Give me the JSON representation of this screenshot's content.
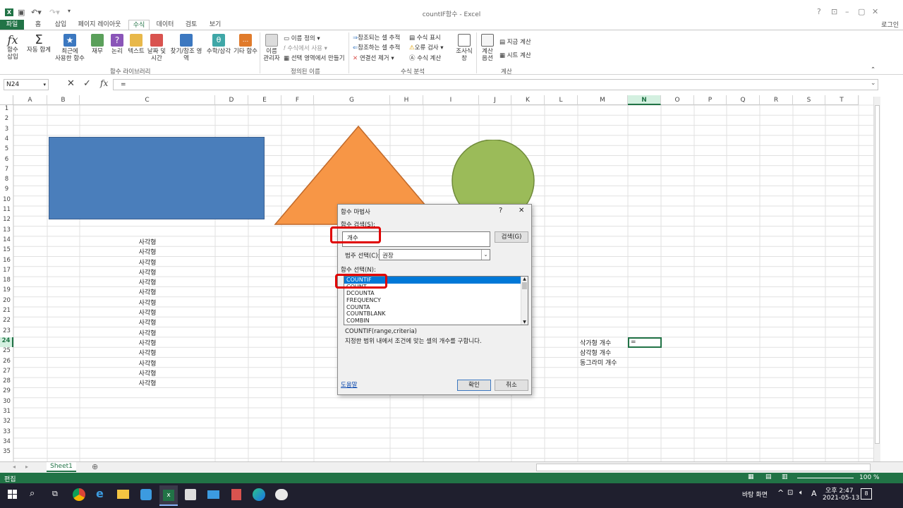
{
  "window": {
    "title": "countIF함수 - Excel",
    "login": "로그인",
    "help_btn": "?",
    "minimize": "–",
    "restore": "▢",
    "close": "✕"
  },
  "tabs": [
    "파일",
    "홈",
    "삽입",
    "페이지 레이아웃",
    "수식",
    "데이터",
    "검토",
    "보기"
  ],
  "ribbon": {
    "insert_function": "fx",
    "insert_function_label1": "함수",
    "insert_function_label2": "삽입",
    "autosum": "자동 합계",
    "recent": "최근에",
    "recent2": "사용한 함수",
    "finance": "재무",
    "logic": "논리",
    "text": "텍스트",
    "datetime": "날짜 및",
    "datetime2": "시간",
    "lookup": "찾기/참조 영역",
    "math": "수학/삼각",
    "more": "기타 함수",
    "group_library": "함수 라이브러리",
    "name_manager": "이름",
    "name_manager2": "관리자",
    "define_name": "이름 정의",
    "use_in_formula": "수식에서 사용",
    "create_from_sel": "선택 영역에서 만들기",
    "group_names": "정의된 이름",
    "trace_precedents": "참조되는 셀 추적",
    "trace_dependents": "참조하는 셀 추적",
    "remove_arrows": "연결선 제거",
    "show_formulas": "수식 표시",
    "error_check": "오류 검사",
    "evaluate": "수식 계산",
    "watch": "조사식",
    "watch2": "창",
    "group_audit": "수식 분석",
    "calc_options": "계산",
    "calc_options2": "옵션",
    "calc_now": "지금 계산",
    "calc_sheet": "시트 계산",
    "group_calc": "계산"
  },
  "formula_bar": {
    "name_box": "N24",
    "formula": "="
  },
  "columns": [
    "A",
    "B",
    "C",
    "D",
    "E",
    "F",
    "G",
    "H",
    "I",
    "J",
    "K",
    "L",
    "M",
    "N",
    "O",
    "P",
    "Q",
    "R",
    "S",
    "T"
  ],
  "rows": [
    "1",
    "2",
    "3",
    "4",
    "5",
    "6",
    "7",
    "8",
    "9",
    "10",
    "11",
    "12",
    "13",
    "14",
    "15",
    "16",
    "17",
    "18",
    "19",
    "20",
    "21",
    "22",
    "23",
    "24",
    "25",
    "26",
    "27",
    "28",
    "29",
    "30",
    "31",
    "32",
    "33",
    "34",
    "35"
  ],
  "cells": {
    "c_values": [
      "사각형",
      "사각형",
      "사각형",
      "사각형",
      "사각형",
      "사각형",
      "사각형",
      "사각형",
      "사각형",
      "사각형",
      "사각형",
      "사각형",
      "사각형",
      "사각형",
      "사각형"
    ],
    "m24": "삭가형 개수",
    "m25": "삼각형 개수",
    "m26": "동그라미 개수",
    "n24": "="
  },
  "shapes": {
    "rect_color": "#4a7ebb",
    "triangle_color": "#f79646",
    "circle_color": "#9bbb59"
  },
  "dialog": {
    "title": "함수 마법사",
    "help": "?",
    "close": "✕",
    "search_label": "함수 검색(S):",
    "search_value": "개수",
    "search_button": "검색(G)",
    "category_label": "범주 선택(C):",
    "category_value": "권장",
    "select_label": "함수 선택(N):",
    "functions": [
      "COUNTIF",
      "COUNT",
      "DCOUNTA",
      "FREQUENCY",
      "COUNTA",
      "COUNTBLANK",
      "COMBIN"
    ],
    "signature": "COUNTIF(range,criteria)",
    "description": "지정한 범위 내에서 조건에 맞는 셀의 개수를 구합니다.",
    "help_link": "도움말",
    "ok": "확인",
    "cancel": "취소"
  },
  "sheet": {
    "tab": "Sheet1",
    "add": "⊕"
  },
  "status": {
    "mode": "편집",
    "zoom": "100 %"
  },
  "taskbar": {
    "desktop": "바탕 화면",
    "lang": "A",
    "time": "오후 2:47",
    "date": "2021-05-13",
    "notif": "8"
  }
}
